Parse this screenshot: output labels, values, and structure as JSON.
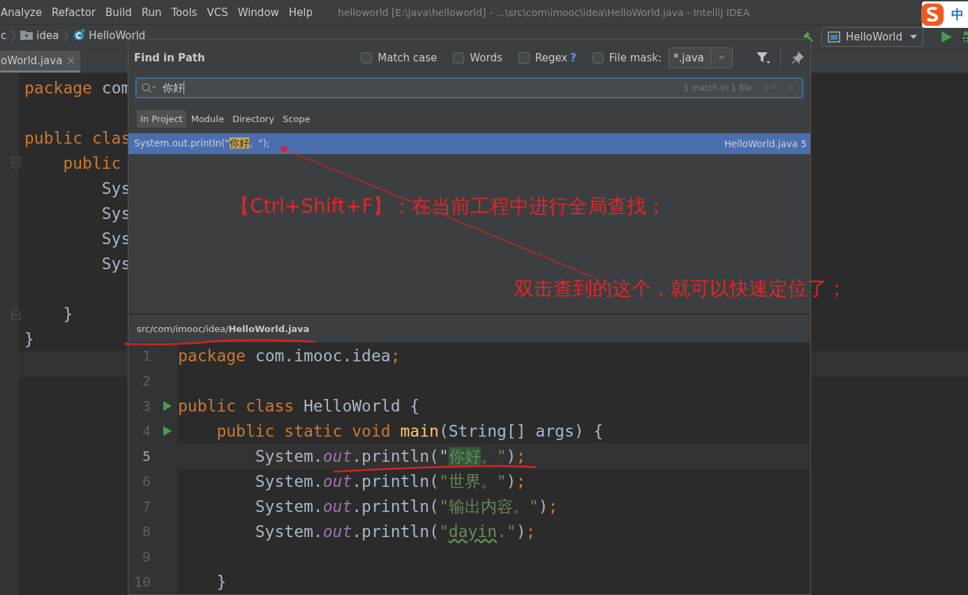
{
  "menu": [
    "Analyze",
    "Refactor",
    "Build",
    "Run",
    "Tools",
    "VCS",
    "Window",
    "Help"
  ],
  "window": {
    "title": "helloworld [E:\\java\\helloworld] - ...\\src\\com\\imooc\\idea\\HelloWorld.java - IntelliJ IDEA"
  },
  "ime": {
    "mode": "中"
  },
  "breadcrumbs": [
    {
      "label": "c",
      "kind": "text"
    },
    {
      "label": "idea",
      "kind": "folder"
    },
    {
      "label": "HelloWorld",
      "kind": "class"
    }
  ],
  "run_config": {
    "label": "HelloWorld"
  },
  "editor_tab": {
    "label": "oWorld.java",
    "selected": true
  },
  "editor": {
    "lines": [
      {
        "kind": "code",
        "tokens": [
          {
            "text": "package",
            "kind": "kw"
          },
          {
            "text": " com",
            "kind": "plain"
          }
        ]
      },
      {
        "kind": "blank"
      },
      {
        "kind": "code",
        "tokens": [
          {
            "text": "public clas",
            "kind": "kw"
          }
        ]
      },
      {
        "kind": "open",
        "tokens": [
          {
            "text": "    public",
            "kind": "kw"
          }
        ]
      },
      {
        "kind": "code",
        "tokens": [
          {
            "text": "        Sys",
            "kind": "plain"
          }
        ]
      },
      {
        "kind": "code",
        "tokens": [
          {
            "text": "        Sys",
            "kind": "plain"
          }
        ]
      },
      {
        "kind": "code",
        "tokens": [
          {
            "text": "        Sys",
            "kind": "plain"
          }
        ]
      },
      {
        "kind": "code",
        "tokens": [
          {
            "text": "        Sys",
            "kind": "plain"
          }
        ]
      },
      {
        "kind": "blank"
      },
      {
        "kind": "close",
        "tokens": [
          {
            "text": "    }",
            "kind": "plain"
          }
        ]
      },
      {
        "kind": "code",
        "tokens": [
          {
            "text": "}",
            "kind": "plain"
          }
        ]
      },
      {
        "kind": "blank",
        "current": true
      }
    ]
  },
  "find_dialog": {
    "title": "Find in Path",
    "options": [
      {
        "label": "Match case",
        "checked": false
      },
      {
        "label": "Words",
        "checked": false
      },
      {
        "label": "Regex",
        "checked": false,
        "help": "?"
      },
      {
        "label": "File mask:",
        "checked": false
      }
    ],
    "file_mask": "*.java",
    "query": "你好",
    "match_count": "1 match in 1 file",
    "scopes": [
      {
        "label": "In Project",
        "selected": true
      },
      {
        "label": "Module",
        "selected": false
      },
      {
        "label": "Directory",
        "selected": false
      },
      {
        "label": "Scope",
        "selected": false
      }
    ],
    "results": [
      {
        "before": "System.out.println(\"",
        "match": "你好",
        "after": "。\");",
        "file": "HelloWorld.java 5",
        "selected": true
      }
    ],
    "preview_path": "src/com/imooc/idea/**HelloWorld.java**",
    "preview": [
      {
        "number": "1",
        "tokens": [
          {
            "text": "package",
            "kind": "kw"
          },
          {
            "text": " com.imooc.idea",
            "kind": "plain"
          },
          {
            "text": ";",
            "kind": "kw"
          }
        ]
      },
      {
        "number": "2"
      },
      {
        "number": "3",
        "runnable": true,
        "tokens": [
          {
            "text": "public class",
            "kind": "kw"
          },
          {
            "text": " HelloWorld {",
            "kind": "plain"
          }
        ]
      },
      {
        "number": "4",
        "runnable": true,
        "tokens": [
          {
            "text": "    public static void",
            "kind": "kw"
          },
          {
            "text": " main",
            "kind": "method"
          },
          {
            "text": "(String[] args) {",
            "kind": "plain"
          }
        ]
      },
      {
        "number": "5",
        "current": true,
        "tokens": [
          {
            "text": "        System.",
            "kind": "plain"
          },
          {
            "text": "out",
            "kind": "field"
          },
          {
            "text": ".println(\"",
            "kind": "plain"
          },
          {
            "text": "你好",
            "kind": "match"
          },
          {
            "text": "。\"",
            "kind": "str"
          },
          {
            "text": ")",
            "kind": "plain"
          },
          {
            "text": ";",
            "kind": "kw"
          }
        ]
      },
      {
        "number": "6",
        "tokens": [
          {
            "text": "        System.",
            "kind": "plain"
          },
          {
            "text": "out",
            "kind": "field"
          },
          {
            "text": ".println(",
            "kind": "plain"
          },
          {
            "text": "\"世界。\"",
            "kind": "str"
          },
          {
            "text": ")",
            "kind": "plain"
          },
          {
            "text": ";",
            "kind": "kw"
          }
        ]
      },
      {
        "number": "7",
        "tokens": [
          {
            "text": "        System.",
            "kind": "plain"
          },
          {
            "text": "out",
            "kind": "field"
          },
          {
            "text": ".println(",
            "kind": "plain"
          },
          {
            "text": "\"输出内容。\"",
            "kind": "str"
          },
          {
            "text": ")",
            "kind": "plain"
          },
          {
            "text": ";",
            "kind": "kw"
          }
        ]
      },
      {
        "number": "8",
        "tokens": [
          {
            "text": "        System.",
            "kind": "plain"
          },
          {
            "text": "out",
            "kind": "field"
          },
          {
            "text": ".println(",
            "kind": "plain"
          },
          {
            "text": "\"",
            "kind": "str"
          },
          {
            "text": "dayin",
            "kind": "typo"
          },
          {
            "text": ".\"",
            "kind": "str"
          },
          {
            "text": ")",
            "kind": "plain"
          },
          {
            "text": ";",
            "kind": "kw"
          }
        ]
      },
      {
        "number": "9"
      },
      {
        "number": "10",
        "tokens": [
          {
            "text": "    }",
            "kind": "plain"
          }
        ]
      }
    ]
  },
  "annotations": [
    "【Ctrl+Shift+F】：在当前工程中进行全局查找；",
    "双击查到的这个，就可以快速定位了；"
  ]
}
